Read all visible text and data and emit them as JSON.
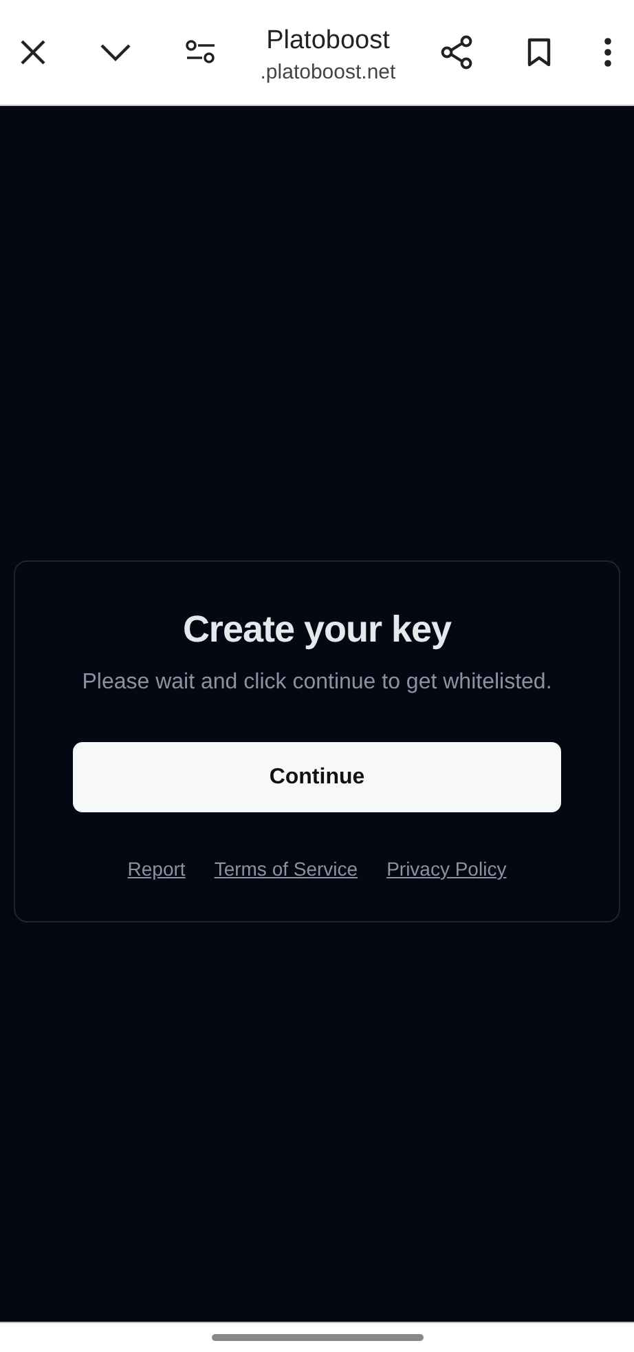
{
  "toolbar": {
    "title": "Platoboost",
    "url": ".platoboost.net"
  },
  "card": {
    "title": "Create your key",
    "subtitle": "Please wait and click continue to get whitelisted.",
    "button": "Continue",
    "links": [
      "Report",
      "Terms of Service",
      "Privacy Policy"
    ]
  }
}
